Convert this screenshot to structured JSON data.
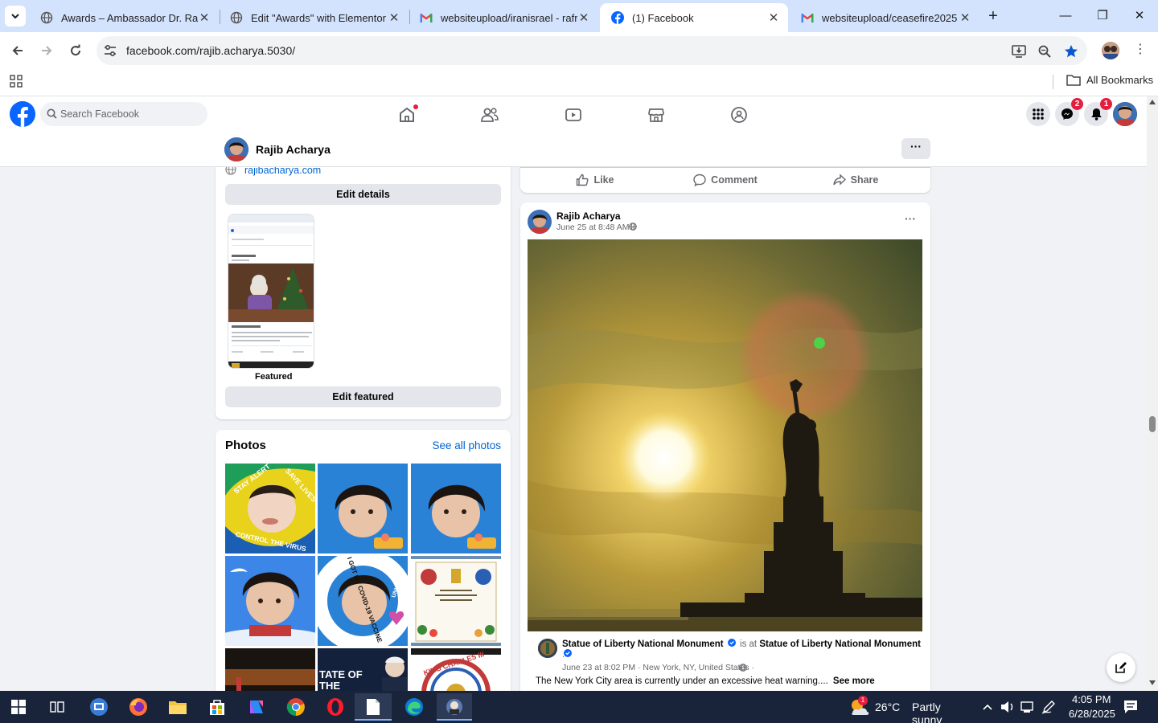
{
  "browser": {
    "tabs": [
      {
        "title": "Awards – Ambassador Dr. Rajib",
        "favicon": "globe-icon",
        "active": false
      },
      {
        "title": "Edit \"Awards\" with Elementor",
        "favicon": "globe-icon",
        "active": false
      },
      {
        "title": "websiteupload/iranisrael - rafre",
        "favicon": "gmail-icon",
        "active": false
      },
      {
        "title": "(1) Facebook",
        "favicon": "facebook-icon",
        "active": true
      },
      {
        "title": "websiteupload/ceasefire2025 -",
        "favicon": "gmail-icon",
        "active": false
      }
    ],
    "url": "facebook.com/rajib.acharya.5030/",
    "bookmarks_label": "All Bookmarks"
  },
  "facebook": {
    "search_placeholder": "Search Facebook",
    "messenger_badge": "2",
    "notifications_badge": "1",
    "profile_name": "Rajib Acharya",
    "more_label": "···"
  },
  "intro": {
    "website": "rajibacharya.com",
    "edit_details": "Edit details",
    "featured_label": "Featured",
    "edit_featured": "Edit featured"
  },
  "photos": {
    "heading": "Photos",
    "see_all": "See all photos",
    "tile1_text_top": "STAY ALERT",
    "tile1_text_right": "SAVE LIVES",
    "tile1_text_bottom": "CONTROL THE VIRUS",
    "tile5_text": "I GOT MY COVID-19 VACCINE",
    "tile5_side": "UNICEF",
    "tile8_text": "TATE OF THE",
    "tile9_text": "KING CHARLES III"
  },
  "prev_post_actions": {
    "like": "Like",
    "comment": "Comment",
    "share": "Share"
  },
  "post": {
    "author": "Rajib Acharya",
    "time": "June 25 at 8:48 AM ·",
    "more": "···",
    "shared_page": "Statue of Liberty National Monument",
    "is_at": "is at",
    "shared_place": "Statue of Liberty National Monument",
    "shared_dot": ".",
    "shared_time": "June 23 at 8:02 PM · New York, NY, United States ·",
    "text": "The New York City area is currently under an excessive heat warning....",
    "see_more": "See more"
  },
  "taskbar": {
    "weather_temp": "26°C",
    "weather_desc": "Partly sunny",
    "weather_badge": "1",
    "time": "4:05 PM",
    "date": "6/28/2025"
  },
  "colors": {
    "facebook_blue": "#0866ff",
    "link_blue": "#0064d1",
    "chrome_tabstrip": "#d3e3fd",
    "badge_red": "#e41e3f",
    "taskbar": "#19243b"
  }
}
